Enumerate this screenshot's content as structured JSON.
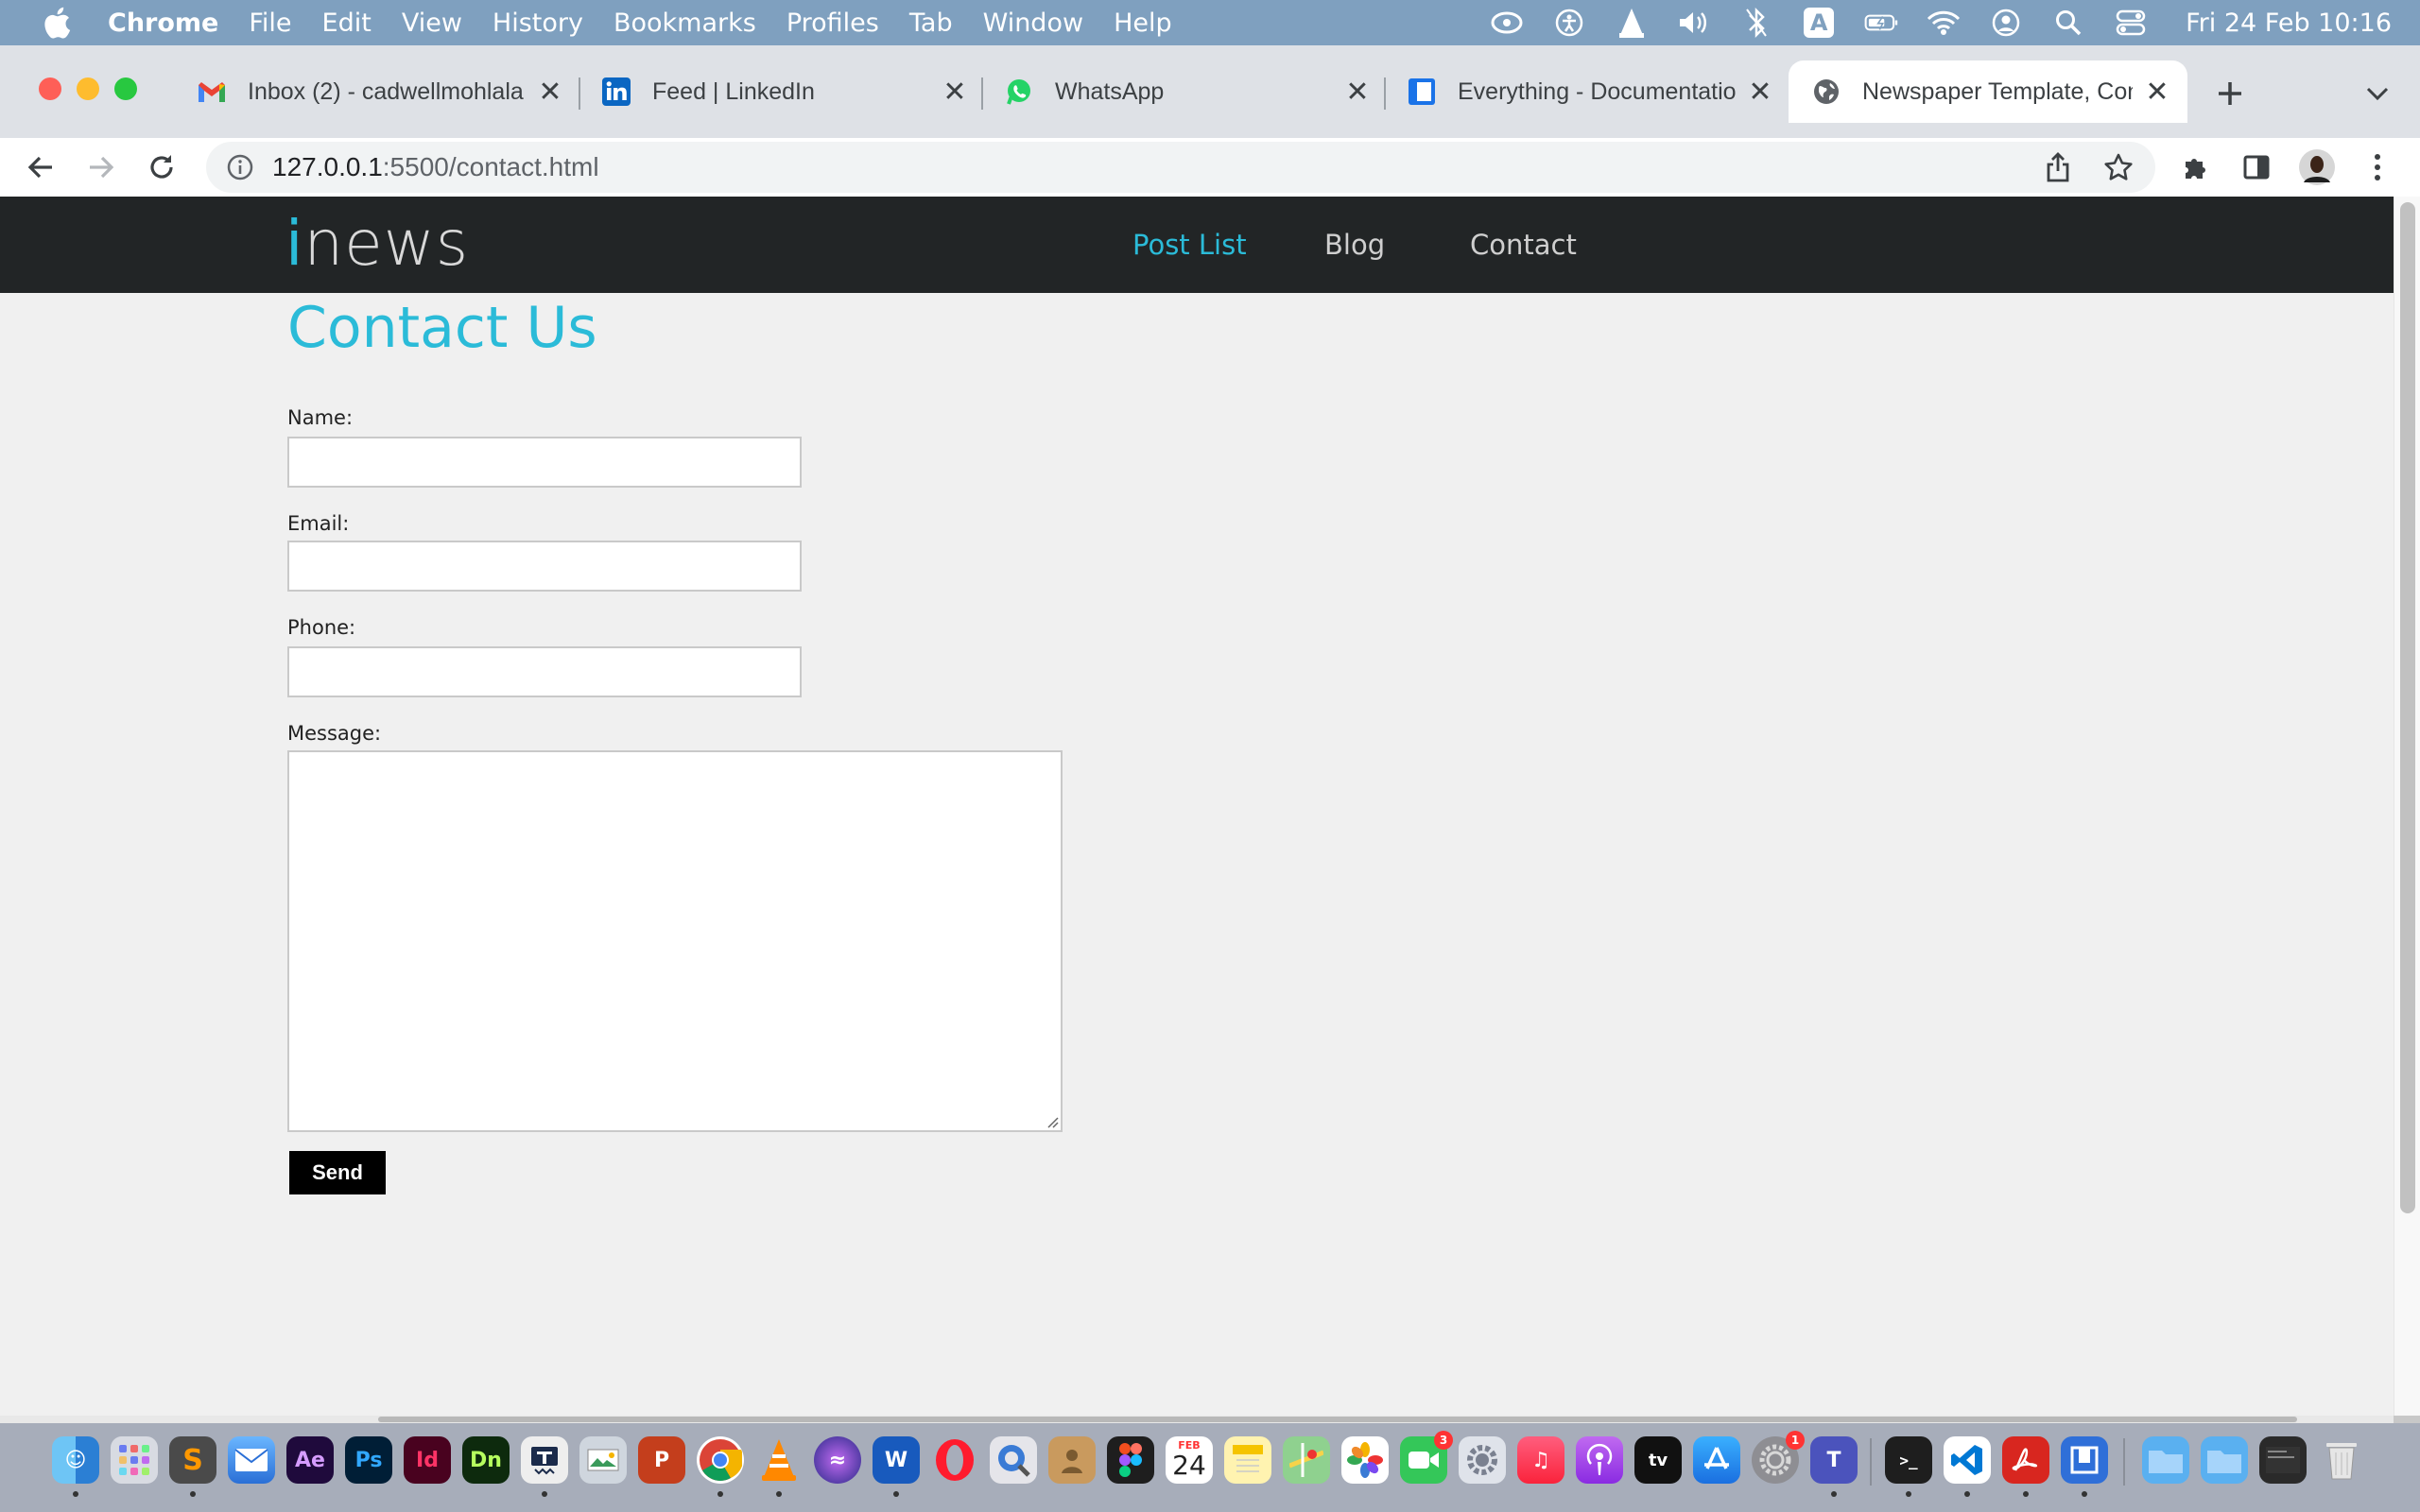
{
  "menubar": {
    "app": "Chrome",
    "items": [
      "File",
      "Edit",
      "View",
      "History",
      "Bookmarks",
      "Profiles",
      "Tab",
      "Window",
      "Help"
    ],
    "clock": "Fri 24 Feb  10:16",
    "input_indicator": "A"
  },
  "tabs": [
    {
      "title": "Inbox (2) - cadwellmohlala",
      "icon": "gmail-icon"
    },
    {
      "title": "Feed | LinkedIn",
      "icon": "linkedin-icon"
    },
    {
      "title": "WhatsApp",
      "icon": "whatsapp-icon"
    },
    {
      "title": "Everything - Documentation",
      "icon": "docs-icon"
    },
    {
      "title": "Newspaper Template, Contact",
      "icon": "globe-icon",
      "active": true
    }
  ],
  "address_bar": {
    "host": "127.0.0.1",
    "rest": ":5500/contact.html"
  },
  "site": {
    "logo_i": "i",
    "logo_rest": "news",
    "nav": [
      {
        "label": "Post List",
        "active": true
      },
      {
        "label": "Blog"
      },
      {
        "label": "Contact"
      }
    ],
    "accent_color": "#2bbbd8",
    "nav_bg": "#222526"
  },
  "contact": {
    "title": "Contact Us",
    "fields": {
      "name_label": "Name:",
      "email_label": "Email:",
      "phone_label": "Phone:",
      "message_label": "Message:"
    },
    "values": {
      "name": "",
      "email": "",
      "phone": "",
      "message": ""
    },
    "send_label": "Send"
  },
  "dock": {
    "calendar_month": "FEB",
    "calendar_day": "24",
    "facetime_badge": "3",
    "settings_badge": "1"
  }
}
